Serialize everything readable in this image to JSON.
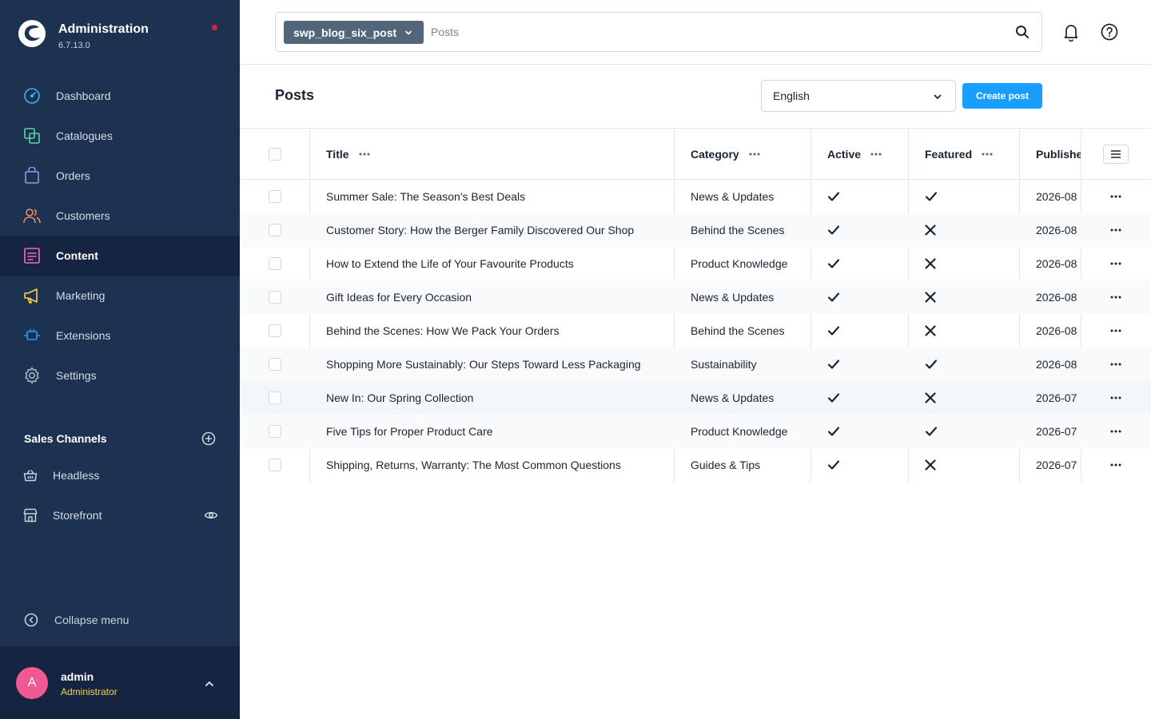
{
  "app": {
    "title": "Administration",
    "version": "6.7.13.0"
  },
  "nav": [
    {
      "label": "Dashboard",
      "icon": "dashboard-icon"
    },
    {
      "label": "Catalogues",
      "icon": "catalogues-icon"
    },
    {
      "label": "Orders",
      "icon": "orders-icon"
    },
    {
      "label": "Customers",
      "icon": "customers-icon"
    },
    {
      "label": "Content",
      "icon": "content-icon",
      "active": true
    },
    {
      "label": "Marketing",
      "icon": "marketing-icon"
    },
    {
      "label": "Extensions",
      "icon": "extensions-icon"
    },
    {
      "label": "Settings",
      "icon": "settings-icon"
    }
  ],
  "sales_channels": {
    "title": "Sales Channels",
    "items": [
      {
        "label": "Headless",
        "icon": "basket-icon"
      },
      {
        "label": "Storefront",
        "icon": "storefront-icon"
      }
    ]
  },
  "collapse_label": "Collapse menu",
  "user": {
    "initial": "A",
    "name": "admin",
    "role": "Administrator"
  },
  "search": {
    "entity": "swp_blog_six_post",
    "placeholder": "Posts"
  },
  "page": {
    "title": "Posts",
    "language": "English",
    "create_label": "Create post"
  },
  "colors": {
    "sidebar": "#1d3151",
    "primary": "#189eff",
    "avatar": "#ef5a93",
    "role": "#ffd43b"
  },
  "grid": {
    "columns": {
      "title": "Title",
      "category": "Category",
      "active": "Active",
      "featured": "Featured",
      "published": "Published"
    },
    "rows": [
      {
        "title": "Summer Sale: The Season's Best Deals",
        "category": "News & Updates",
        "active": true,
        "featured": true,
        "published": "2026-08"
      },
      {
        "title": "Customer Story: How the Berger Family Discovered Our Shop",
        "category": "Behind the Scenes",
        "active": true,
        "featured": false,
        "published": "2026-08"
      },
      {
        "title": "How to Extend the Life of Your Favourite Products",
        "category": "Product Knowledge",
        "active": true,
        "featured": false,
        "published": "2026-08"
      },
      {
        "title": "Gift Ideas for Every Occasion",
        "category": "News & Updates",
        "active": true,
        "featured": false,
        "published": "2026-08"
      },
      {
        "title": "Behind the Scenes: How We Pack Your Orders",
        "category": "Behind the Scenes",
        "active": true,
        "featured": false,
        "published": "2026-08"
      },
      {
        "title": "Shopping More Sustainably: Our Steps Toward Less Packaging",
        "category": "Sustainability",
        "active": true,
        "featured": true,
        "published": "2026-08"
      },
      {
        "title": "New In: Our Spring Collection",
        "category": "News & Updates",
        "active": true,
        "featured": false,
        "published": "2026-07"
      },
      {
        "title": "Five Tips for Proper Product Care",
        "category": "Product Knowledge",
        "active": true,
        "featured": true,
        "published": "2026-07"
      },
      {
        "title": "Shipping, Returns, Warranty: The Most Common Questions",
        "category": "Guides & Tips",
        "active": true,
        "featured": false,
        "published": "2026-07"
      }
    ]
  }
}
